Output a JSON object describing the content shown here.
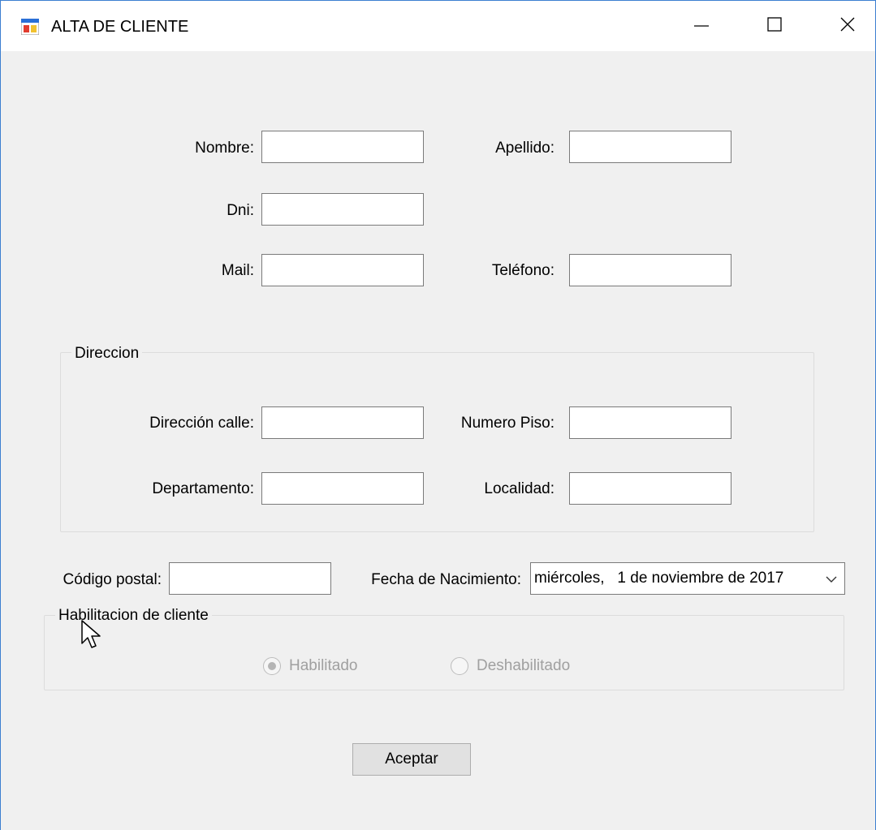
{
  "window": {
    "title": "ALTA DE CLIENTE",
    "icon": "form-app-icon",
    "controls": [
      "minimize-icon",
      "maximize-icon",
      "close-icon"
    ]
  },
  "form": {
    "nombre_label": "Nombre:",
    "nombre_value": "",
    "apellido_label": "Apellido:",
    "apellido_value": "",
    "dni_label": "Dni:",
    "dni_value": "",
    "mail_label": "Mail:",
    "mail_value": "",
    "telefono_label": "Teléfono:",
    "telefono_value": ""
  },
  "direccion": {
    "group_title": "Direccion",
    "calle_label": "Dirección calle:",
    "calle_value": "",
    "piso_label": "Numero Piso:",
    "piso_value": "",
    "departamento_label": "Departamento:",
    "departamento_value": "",
    "localidad_label": "Localidad:",
    "localidad_value": ""
  },
  "extra": {
    "codigo_postal_label": "Código postal:",
    "codigo_postal_value": "",
    "fecha_label": "Fecha de Nacimiento:",
    "fecha_value": "miércoles,   1 de noviembre de 2017"
  },
  "habilitacion": {
    "group_title": "Habilitacion de cliente",
    "habilitado_label": "Habilitado",
    "habilitado_checked": true,
    "deshabilitado_label": "Deshabilitado",
    "deshabilitado_checked": false,
    "enabled": false
  },
  "actions": {
    "aceptar_label": "Aceptar"
  },
  "colors": {
    "window_border": "#3c7fd1",
    "form_background": "#f0f0f0",
    "disabled_text": "#a0a0a0"
  }
}
